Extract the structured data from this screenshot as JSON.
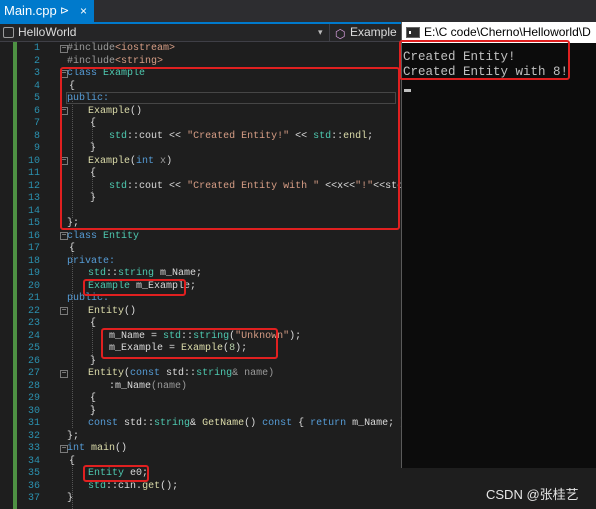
{
  "tab": {
    "title": "Main.cpp",
    "pin_icon": "⊳",
    "close_icon": "×"
  },
  "nav": {
    "project": "HelloWorld",
    "scope": "Example",
    "dropdown_icon": "▾"
  },
  "line_numbers": [
    "1",
    "2",
    "3",
    "4",
    "5",
    "6",
    "7",
    "8",
    "9",
    "10",
    "11",
    "12",
    "13",
    "14",
    "15",
    "16",
    "17",
    "18",
    "19",
    "20",
    "21",
    "22",
    "23",
    "24",
    "25",
    "26",
    "27",
    "28",
    "29",
    "30",
    "31",
    "32",
    "33",
    "34",
    "35",
    "36",
    "37"
  ],
  "code": {
    "l1a": "#include",
    "l1b": "<iostream>",
    "l2a": "#include",
    "l2b": "<string>",
    "l3a": "class ",
    "l3b": "Example",
    "l4": "{",
    "l5": "public:",
    "l6a": "Example",
    "l6b": "()",
    "l7": "{",
    "l8a": "std",
    "l8b": "::",
    "l8c": "cout",
    "l8d": " << ",
    "l8e": "\"Created Entity!\"",
    "l8f": " << ",
    "l8g": "std",
    "l8h": "::",
    "l8i": "endl",
    "l8j": ";",
    "l9": "}",
    "l10a": "Example",
    "l10b": "(",
    "l10c": "int",
    "l10d": " x",
    "l10e": ")",
    "l11": "{",
    "l12a": "std",
    "l12b": "::",
    "l12c": "cout",
    "l12d": " << ",
    "l12e": "\"Created Entity with \"",
    "l12f": " <<x<<",
    "l12g": "\"!\"",
    "l12h": "<<std::endl;",
    "l13": "}",
    "l14": "",
    "l15": "};",
    "l16a": "class ",
    "l16b": "Entity",
    "l17": "{",
    "l18": "private:",
    "l19a": "std",
    "l19b": "::",
    "l19c": "string",
    "l19d": " m_Name;",
    "l20a": "Example",
    "l20b": " m_Example;",
    "l21": "public:",
    "l22a": "Entity",
    "l22b": "()",
    "l23": "{",
    "l24a": "m_Name",
    "l24b": " = ",
    "l24c": "std",
    "l24d": "::",
    "l24e": "string",
    "l24f": "(",
    "l24g": "\"Unknown\"",
    "l24h": ");",
    "l25a": "m_Example",
    "l25b": " = ",
    "l25c": "Example",
    "l25d": "(",
    "l25e": "8",
    "l25f": ");",
    "l26": "}",
    "l27a": "Entity",
    "l27b": "(",
    "l27c": "const",
    "l27d": " std::",
    "l27e": "string",
    "l27f": "& name)",
    "l28a": ":",
    "l28b": "m_Name",
    "l28c": "(name)",
    "l29": "{",
    "l30": "}",
    "l31a": "const",
    "l31b": " std::",
    "l31c": "string",
    "l31d": "& ",
    "l31e": "GetName",
    "l31f": "() ",
    "l31g": "const",
    "l31h": " { ",
    "l31i": "return",
    "l31j": " m_Name; }",
    "l32": "};",
    "l33a": "int",
    "l33b": " ",
    "l33c": "main",
    "l33d": "()",
    "l34": "{",
    "l35a": "Entity",
    "l35b": " e0;",
    "l36a": "std",
    "l36b": "::",
    "l36c": "cin",
    "l36d": ".",
    "l36e": "get",
    "l36f": "();",
    "l37": "}"
  },
  "console": {
    "title": "E:\\C code\\Cherno\\Helloworld\\D",
    "lines": [
      "Created Entity!",
      "Created Entity with 8!"
    ]
  },
  "watermark": "CSDN @张桂艺",
  "colors": {
    "accent": "#007acc",
    "annotation": "#e02020",
    "keyword": "#569cd6",
    "type": "#4ec9b0",
    "string": "#d69d85"
  }
}
